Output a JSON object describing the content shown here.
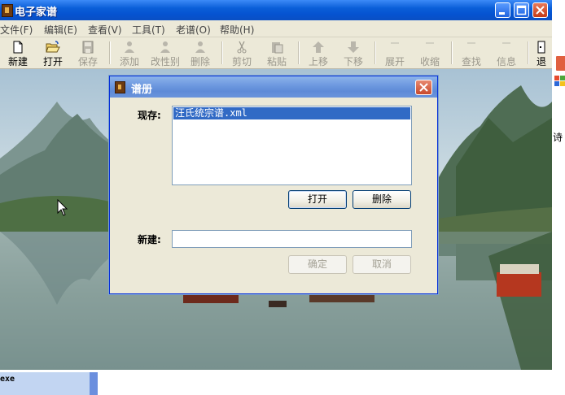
{
  "main_window": {
    "title": "电子家谱"
  },
  "menu": [
    {
      "label": "文件(F)"
    },
    {
      "label": "编辑(E)"
    },
    {
      "label": "查看(V)"
    },
    {
      "label": "工具(T)"
    },
    {
      "label": "老谱(O)"
    },
    {
      "label": "帮助(H)"
    }
  ],
  "toolbar": [
    {
      "label": "新建",
      "icon": "new-file-icon",
      "enabled": true
    },
    {
      "label": "打开",
      "icon": "open-folder-icon",
      "enabled": true
    },
    {
      "label": "保存",
      "icon": "save-icon",
      "enabled": false
    },
    {
      "label": "添加",
      "icon": "add-person-icon",
      "enabled": false
    },
    {
      "label": "改性别",
      "icon": "change-gender-icon",
      "enabled": false
    },
    {
      "label": "删除",
      "icon": "delete-person-icon",
      "enabled": false
    },
    {
      "label": "剪切",
      "icon": "scissors-icon",
      "enabled": false
    },
    {
      "label": "粘贴",
      "icon": "paste-icon",
      "enabled": false
    },
    {
      "label": "上移",
      "icon": "arrow-up-icon",
      "enabled": false
    },
    {
      "label": "下移",
      "icon": "arrow-down-icon",
      "enabled": false
    },
    {
      "label": "展开",
      "icon": "expand-icon",
      "enabled": false
    },
    {
      "label": "收缩",
      "icon": "collapse-icon",
      "enabled": false
    },
    {
      "label": "查找",
      "icon": "find-icon",
      "enabled": false
    },
    {
      "label": "信息",
      "icon": "info-icon",
      "enabled": false
    },
    {
      "label": "退",
      "icon": "exit-icon",
      "enabled": true
    }
  ],
  "dialog": {
    "title": "谱册",
    "existing_label": "现存:",
    "existing_items": [
      "汪氏统宗谱.xml"
    ],
    "open_button": "打开",
    "delete_button": "删除",
    "new_label": "新建:",
    "new_value": "",
    "ok_button": "确定",
    "cancel_button": "取消"
  },
  "right_edge": {
    "partial_text": "诗"
  },
  "taskbar": {
    "item_text": "exe"
  },
  "colors": {
    "title_bar": "#0553d1",
    "dialog_title_bar": "#6f9ae0",
    "selection": "#316ac5",
    "window_face": "#ece9d8"
  }
}
